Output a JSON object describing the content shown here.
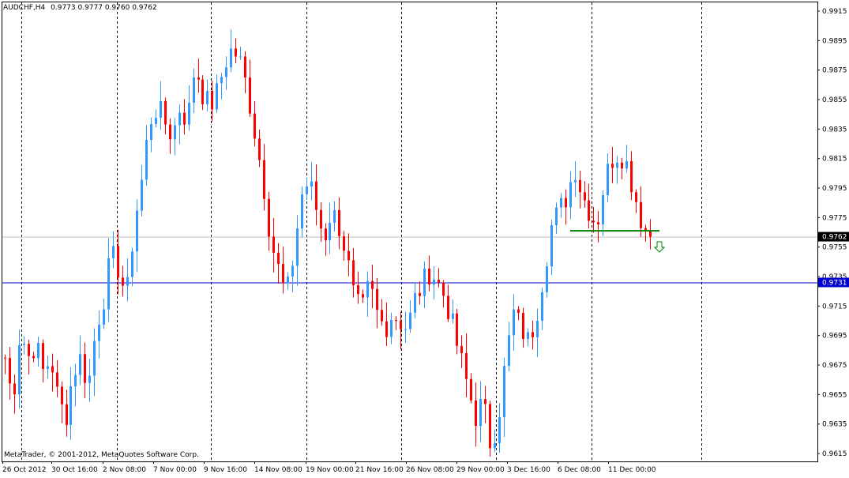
{
  "chart_header": {
    "symbol_tf": "AUDCHF,H4",
    "ohlc": "0.9773 0.9777 0.9760 0.9762"
  },
  "watermark": "MetaTrader, © 2001-2012, MetaQuotes Software Corp.",
  "colors": {
    "background": "#ffffff",
    "bull": "#3399ff",
    "bear": "#ff0000",
    "grid": "#000000",
    "bid_line": "#c0c0c0",
    "hline_blue": "#0000cc",
    "support_line": "#008000",
    "arrow": "#008000"
  },
  "price_axis": {
    "ticks": [
      "0.9915",
      "0.9895",
      "0.9875",
      "0.9855",
      "0.9835",
      "0.9815",
      "0.9795",
      "0.9775",
      "0.9755",
      "0.9735",
      "0.9715",
      "0.9695",
      "0.9675",
      "0.9655",
      "0.9635",
      "0.9615"
    ],
    "current_price_label": "0.9762",
    "hline_label": "0.9731"
  },
  "time_axis": {
    "labels": [
      "26 Oct 2012",
      "30 Oct 16:00",
      "2 Nov 08:00",
      "7 Nov 00:00",
      "9 Nov 16:00",
      "14 Nov 08:00",
      "19 Nov 00:00",
      "21 Nov 16:00",
      "26 Nov 08:00",
      "29 Nov 00:00",
      "3 Dec 16:00",
      "6 Dec 08:00",
      "11 Dec 00:00"
    ]
  },
  "chart_data": {
    "type": "candlestick",
    "symbol": "AUDCHF",
    "timeframe": "H4",
    "ylim": [
      0.9615,
      0.992
    ],
    "path": [
      0.968,
      0.965,
      0.97,
      0.968,
      0.969,
      0.967,
      0.968,
      0.965,
      0.964,
      0.967,
      0.968,
      0.966,
      0.97,
      0.972,
      0.975,
      0.974,
      0.972,
      0.977,
      0.98,
      0.984,
      0.985,
      0.984,
      0.983,
      0.985,
      0.984,
      0.988,
      0.986,
      0.985,
      0.986,
      0.988,
      0.989,
      0.988,
      0.986,
      0.983,
      0.98,
      0.976,
      0.974,
      0.972,
      0.975,
      0.979,
      0.98,
      0.978,
      0.976,
      0.978,
      0.977,
      0.975,
      0.972,
      0.971,
      0.973,
      0.971,
      0.97,
      0.971,
      0.9705,
      0.97,
      0.972,
      0.973,
      0.974,
      0.973,
      0.972,
      0.97,
      0.968,
      0.966,
      0.964,
      0.965,
      0.962,
      0.964,
      0.968,
      0.971,
      0.97,
      0.969,
      0.971,
      0.974,
      0.977,
      0.978,
      0.979,
      0.981,
      0.979,
      0.978,
      0.977,
      0.98,
      0.9815,
      0.982,
      0.981,
      0.979,
      0.977,
      0.9762
    ],
    "candle_count": 138,
    "current_price": 0.9762,
    "horizontal_lines": [
      {
        "price": 0.9731,
        "color": "#0000cc"
      },
      {
        "price": 0.9762,
        "color": "#c0c0c0"
      }
    ],
    "support_segment": {
      "price": 0.9766,
      "color": "#008000"
    },
    "signal": "down-arrow",
    "xlabel": "",
    "ylabel": ""
  }
}
